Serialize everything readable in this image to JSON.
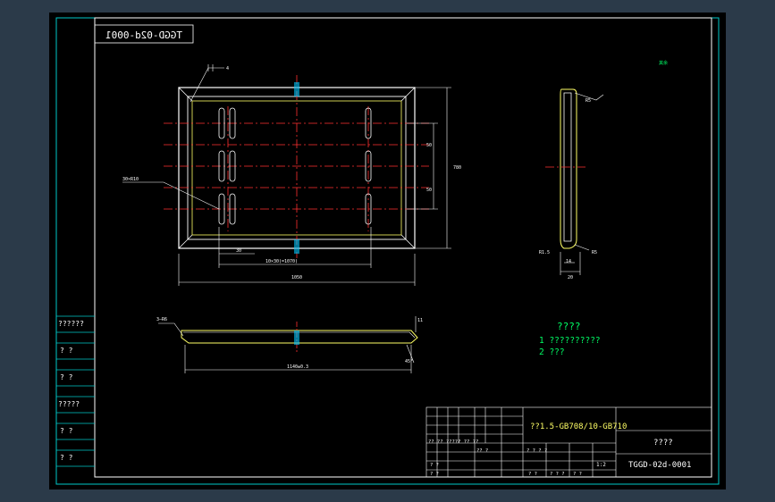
{
  "drawing_code_mirrored": "TGGD-02d-0001",
  "weld_symbol_label": "4",
  "callout_top_right": "其余",
  "callout_left_slot": "30×R10",
  "dims": {
    "slot_spacing": "30",
    "slot_group_length": "10×30(=1070)",
    "overall_width": "1050",
    "height_a": "50",
    "height_b": "50",
    "overall_height": "780",
    "section_r": "R5",
    "section_radius_small": "R1.5",
    "section_width_inner": "14",
    "section_width_outer": "20",
    "side_height": "11",
    "side_len": "1140±0.3",
    "side_angle": "45°",
    "side_left": "3—R6"
  },
  "notes": {
    "title": "????",
    "line1": "1 ??????????",
    "line2": "2 ???"
  },
  "left_column": {
    "cells": [
      "??????",
      "?   ?",
      "?   ?",
      "?????",
      "?   ?",
      "?   ?"
    ]
  },
  "title_block": {
    "material": "??1.5-GB708/10-GB710",
    "part_name": "????",
    "drawing_number": "TGGD-02d-0001",
    "scale": "1:2",
    "row_labels": [
      "?? ?? ????? ?? ??",
      "?? ?",
      "? ?",
      "? ?"
    ],
    "small_cells": [
      "? ? ? ?",
      "? ?",
      "? ? ?",
      "? ?"
    ]
  }
}
